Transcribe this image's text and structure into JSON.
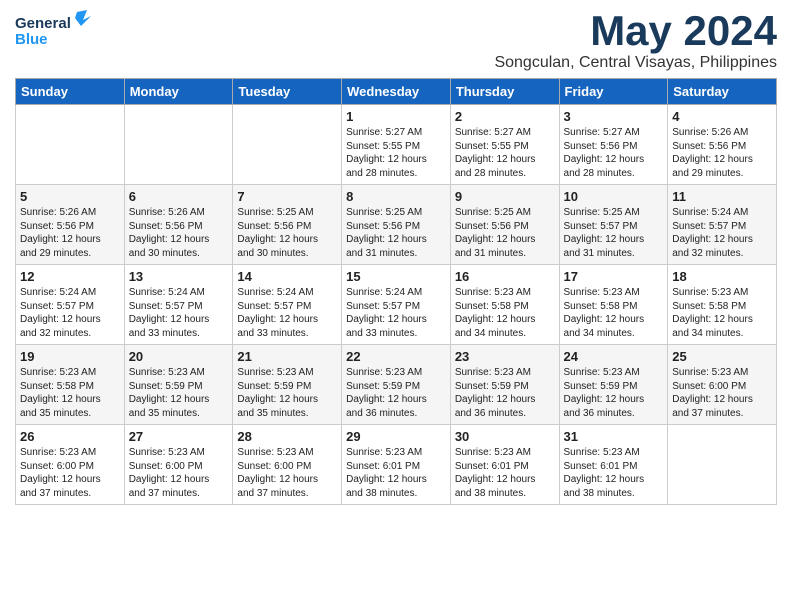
{
  "header": {
    "logo_general": "General",
    "logo_blue": "Blue",
    "month": "May 2024",
    "location": "Songculan, Central Visayas, Philippines"
  },
  "weekdays": [
    "Sunday",
    "Monday",
    "Tuesday",
    "Wednesday",
    "Thursday",
    "Friday",
    "Saturday"
  ],
  "weeks": [
    [
      {
        "day": "",
        "info": ""
      },
      {
        "day": "",
        "info": ""
      },
      {
        "day": "",
        "info": ""
      },
      {
        "day": "1",
        "info": "Sunrise: 5:27 AM\nSunset: 5:55 PM\nDaylight: 12 hours\nand 28 minutes."
      },
      {
        "day": "2",
        "info": "Sunrise: 5:27 AM\nSunset: 5:55 PM\nDaylight: 12 hours\nand 28 minutes."
      },
      {
        "day": "3",
        "info": "Sunrise: 5:27 AM\nSunset: 5:56 PM\nDaylight: 12 hours\nand 28 minutes."
      },
      {
        "day": "4",
        "info": "Sunrise: 5:26 AM\nSunset: 5:56 PM\nDaylight: 12 hours\nand 29 minutes."
      }
    ],
    [
      {
        "day": "5",
        "info": "Sunrise: 5:26 AM\nSunset: 5:56 PM\nDaylight: 12 hours\nand 29 minutes."
      },
      {
        "day": "6",
        "info": "Sunrise: 5:26 AM\nSunset: 5:56 PM\nDaylight: 12 hours\nand 30 minutes."
      },
      {
        "day": "7",
        "info": "Sunrise: 5:25 AM\nSunset: 5:56 PM\nDaylight: 12 hours\nand 30 minutes."
      },
      {
        "day": "8",
        "info": "Sunrise: 5:25 AM\nSunset: 5:56 PM\nDaylight: 12 hours\nand 31 minutes."
      },
      {
        "day": "9",
        "info": "Sunrise: 5:25 AM\nSunset: 5:56 PM\nDaylight: 12 hours\nand 31 minutes."
      },
      {
        "day": "10",
        "info": "Sunrise: 5:25 AM\nSunset: 5:57 PM\nDaylight: 12 hours\nand 31 minutes."
      },
      {
        "day": "11",
        "info": "Sunrise: 5:24 AM\nSunset: 5:57 PM\nDaylight: 12 hours\nand 32 minutes."
      }
    ],
    [
      {
        "day": "12",
        "info": "Sunrise: 5:24 AM\nSunset: 5:57 PM\nDaylight: 12 hours\nand 32 minutes."
      },
      {
        "day": "13",
        "info": "Sunrise: 5:24 AM\nSunset: 5:57 PM\nDaylight: 12 hours\nand 33 minutes."
      },
      {
        "day": "14",
        "info": "Sunrise: 5:24 AM\nSunset: 5:57 PM\nDaylight: 12 hours\nand 33 minutes."
      },
      {
        "day": "15",
        "info": "Sunrise: 5:24 AM\nSunset: 5:57 PM\nDaylight: 12 hours\nand 33 minutes."
      },
      {
        "day": "16",
        "info": "Sunrise: 5:23 AM\nSunset: 5:58 PM\nDaylight: 12 hours\nand 34 minutes."
      },
      {
        "day": "17",
        "info": "Sunrise: 5:23 AM\nSunset: 5:58 PM\nDaylight: 12 hours\nand 34 minutes."
      },
      {
        "day": "18",
        "info": "Sunrise: 5:23 AM\nSunset: 5:58 PM\nDaylight: 12 hours\nand 34 minutes."
      }
    ],
    [
      {
        "day": "19",
        "info": "Sunrise: 5:23 AM\nSunset: 5:58 PM\nDaylight: 12 hours\nand 35 minutes."
      },
      {
        "day": "20",
        "info": "Sunrise: 5:23 AM\nSunset: 5:59 PM\nDaylight: 12 hours\nand 35 minutes."
      },
      {
        "day": "21",
        "info": "Sunrise: 5:23 AM\nSunset: 5:59 PM\nDaylight: 12 hours\nand 35 minutes."
      },
      {
        "day": "22",
        "info": "Sunrise: 5:23 AM\nSunset: 5:59 PM\nDaylight: 12 hours\nand 36 minutes."
      },
      {
        "day": "23",
        "info": "Sunrise: 5:23 AM\nSunset: 5:59 PM\nDaylight: 12 hours\nand 36 minutes."
      },
      {
        "day": "24",
        "info": "Sunrise: 5:23 AM\nSunset: 5:59 PM\nDaylight: 12 hours\nand 36 minutes."
      },
      {
        "day": "25",
        "info": "Sunrise: 5:23 AM\nSunset: 6:00 PM\nDaylight: 12 hours\nand 37 minutes."
      }
    ],
    [
      {
        "day": "26",
        "info": "Sunrise: 5:23 AM\nSunset: 6:00 PM\nDaylight: 12 hours\nand 37 minutes."
      },
      {
        "day": "27",
        "info": "Sunrise: 5:23 AM\nSunset: 6:00 PM\nDaylight: 12 hours\nand 37 minutes."
      },
      {
        "day": "28",
        "info": "Sunrise: 5:23 AM\nSunset: 6:00 PM\nDaylight: 12 hours\nand 37 minutes."
      },
      {
        "day": "29",
        "info": "Sunrise: 5:23 AM\nSunset: 6:01 PM\nDaylight: 12 hours\nand 38 minutes."
      },
      {
        "day": "30",
        "info": "Sunrise: 5:23 AM\nSunset: 6:01 PM\nDaylight: 12 hours\nand 38 minutes."
      },
      {
        "day": "31",
        "info": "Sunrise: 5:23 AM\nSunset: 6:01 PM\nDaylight: 12 hours\nand 38 minutes."
      },
      {
        "day": "",
        "info": ""
      }
    ]
  ]
}
